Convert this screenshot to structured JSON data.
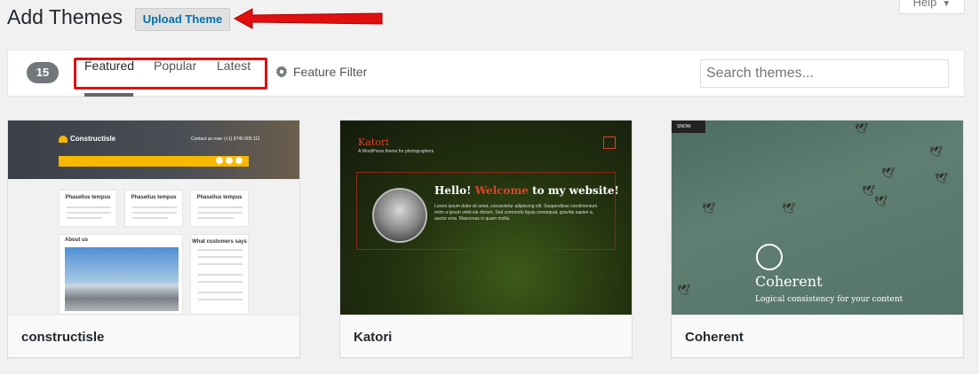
{
  "header": {
    "title": "Add Themes",
    "upload_label": "Upload Theme",
    "help_label": "Help"
  },
  "filter_bar": {
    "count": "15",
    "tabs": [
      {
        "label": "Featured",
        "current": true
      },
      {
        "label": "Popular",
        "current": false
      },
      {
        "label": "Latest",
        "current": false
      }
    ],
    "feature_filter_label": "Feature Filter",
    "search_placeholder": "Search themes..."
  },
  "themes": [
    {
      "name": "constructisle",
      "preview": {
        "logo": "Constructisle",
        "contact": "Contact us now: (+1) 0745.000.111",
        "cards": [
          "Phasellus tempus",
          "Phasellus tempus",
          "Phasellus tempus"
        ],
        "about": "About us",
        "customers": "What customers says"
      }
    },
    {
      "name": "Katori",
      "preview": {
        "logo": "Katori",
        "tagline": "A WordPress theme for photographers",
        "hello_pre": "Hello!",
        "hello_highlight": "Welcome",
        "hello_post": "to my website!",
        "body": "Lorem ipsum dolor sit amet, consectetur adipiscing elit. Suspendisse condimentum enim a ipsum vehicula dictum. Sed commodo ligula consequat, gravida sapien a, auctor eros. Maecenas in quam mollis."
      }
    },
    {
      "name": "Coherent",
      "preview": {
        "tag": "SNOW",
        "title": "Coherent",
        "subtitle": "Logical consistency for your content"
      }
    }
  ],
  "colors": {
    "accent": "#0073aa",
    "highlight_red": "#e01010",
    "background": "#f1f1f1"
  }
}
